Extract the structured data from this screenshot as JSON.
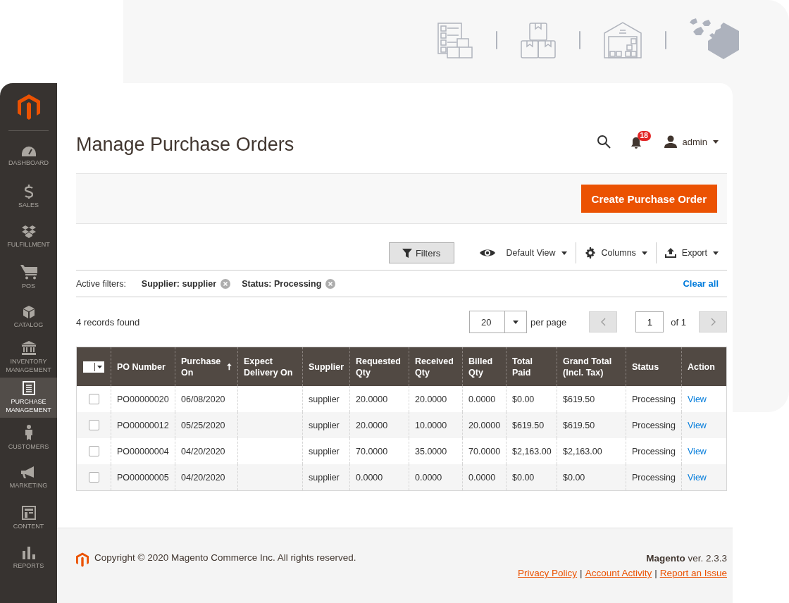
{
  "sidebar": {
    "items": [
      {
        "label": "DASHBOARD",
        "selected": false
      },
      {
        "label": "SALES",
        "selected": false
      },
      {
        "label": "FULFILLMENT",
        "selected": false
      },
      {
        "label": "POS",
        "selected": false
      },
      {
        "label": "CATALOG",
        "selected": false
      },
      {
        "label": "INVENTORY MANAGEMENT",
        "selected": false
      },
      {
        "label": "PURCHASE MANAGEMENT",
        "selected": true
      },
      {
        "label": "CUSTOMERS",
        "selected": false
      },
      {
        "label": "MARKETING",
        "selected": false
      },
      {
        "label": "CONTENT",
        "selected": false
      },
      {
        "label": "REPORTS",
        "selected": false
      }
    ]
  },
  "header": {
    "title": "Manage Purchase Orders",
    "notification_count": "18",
    "user": "admin"
  },
  "page_actions": {
    "primary_button": "Create Purchase Order"
  },
  "toolbar": {
    "filters_button": "Filters",
    "view": "Default View",
    "columns": "Columns",
    "export": "Export"
  },
  "active_filters": {
    "label": "Active filters:",
    "filters": [
      "Supplier: supplier",
      "Status: Processing"
    ],
    "clear": "Clear all"
  },
  "pager": {
    "records": "4 records found",
    "per_page": "20",
    "per_page_label": "per page",
    "page": "1",
    "of": "of 1"
  },
  "table": {
    "columns": [
      {
        "label": "PO Number",
        "sorted": false
      },
      {
        "label": "Purchase On",
        "sorted": true
      },
      {
        "label": "Expect Delivery On",
        "sorted": false
      },
      {
        "label": "Supplier",
        "sorted": false
      },
      {
        "label": "Requested Qty",
        "sorted": false
      },
      {
        "label": "Received Qty",
        "sorted": false
      },
      {
        "label": "Billed Qty",
        "sorted": false
      },
      {
        "label": "Total Paid",
        "sorted": false
      },
      {
        "label": "Grand Total (Incl. Tax)",
        "sorted": false
      },
      {
        "label": "Status",
        "sorted": false
      },
      {
        "label": "Action",
        "sorted": false
      }
    ],
    "rows": [
      {
        "checked": false,
        "cells": [
          "PO00000020",
          "06/08/2020",
          "",
          "supplier",
          "20.0000",
          "20.0000",
          "0.0000",
          "$0.00",
          "$619.50",
          "Processing",
          "View"
        ]
      },
      {
        "checked": false,
        "cells": [
          "PO00000012",
          "05/25/2020",
          "",
          "supplier",
          "20.0000",
          "10.0000",
          "20.0000",
          "$619.50",
          "$619.50",
          "Processing",
          "View"
        ]
      },
      {
        "checked": false,
        "cells": [
          "PO00000004",
          "04/20/2020",
          "",
          "supplier",
          "70.0000",
          "35.0000",
          "70.0000",
          "$2,163.00",
          "$2,163.00",
          "Processing",
          "View"
        ]
      },
      {
        "checked": false,
        "cells": [
          "PO00000005",
          "04/20/2020",
          "",
          "supplier",
          "0.0000",
          "0.0000",
          "0.0000",
          "$0.00",
          "$0.00",
          "Processing",
          "View"
        ]
      }
    ]
  },
  "footer": {
    "copyright": "Copyright © 2020 Magento Commerce Inc. All rights reserved.",
    "version": "**Magento** ver. 2.3.3",
    "links": [
      "Privacy Policy",
      "Account Activity",
      "Report an Issue"
    ],
    "link_separator": "|"
  }
}
